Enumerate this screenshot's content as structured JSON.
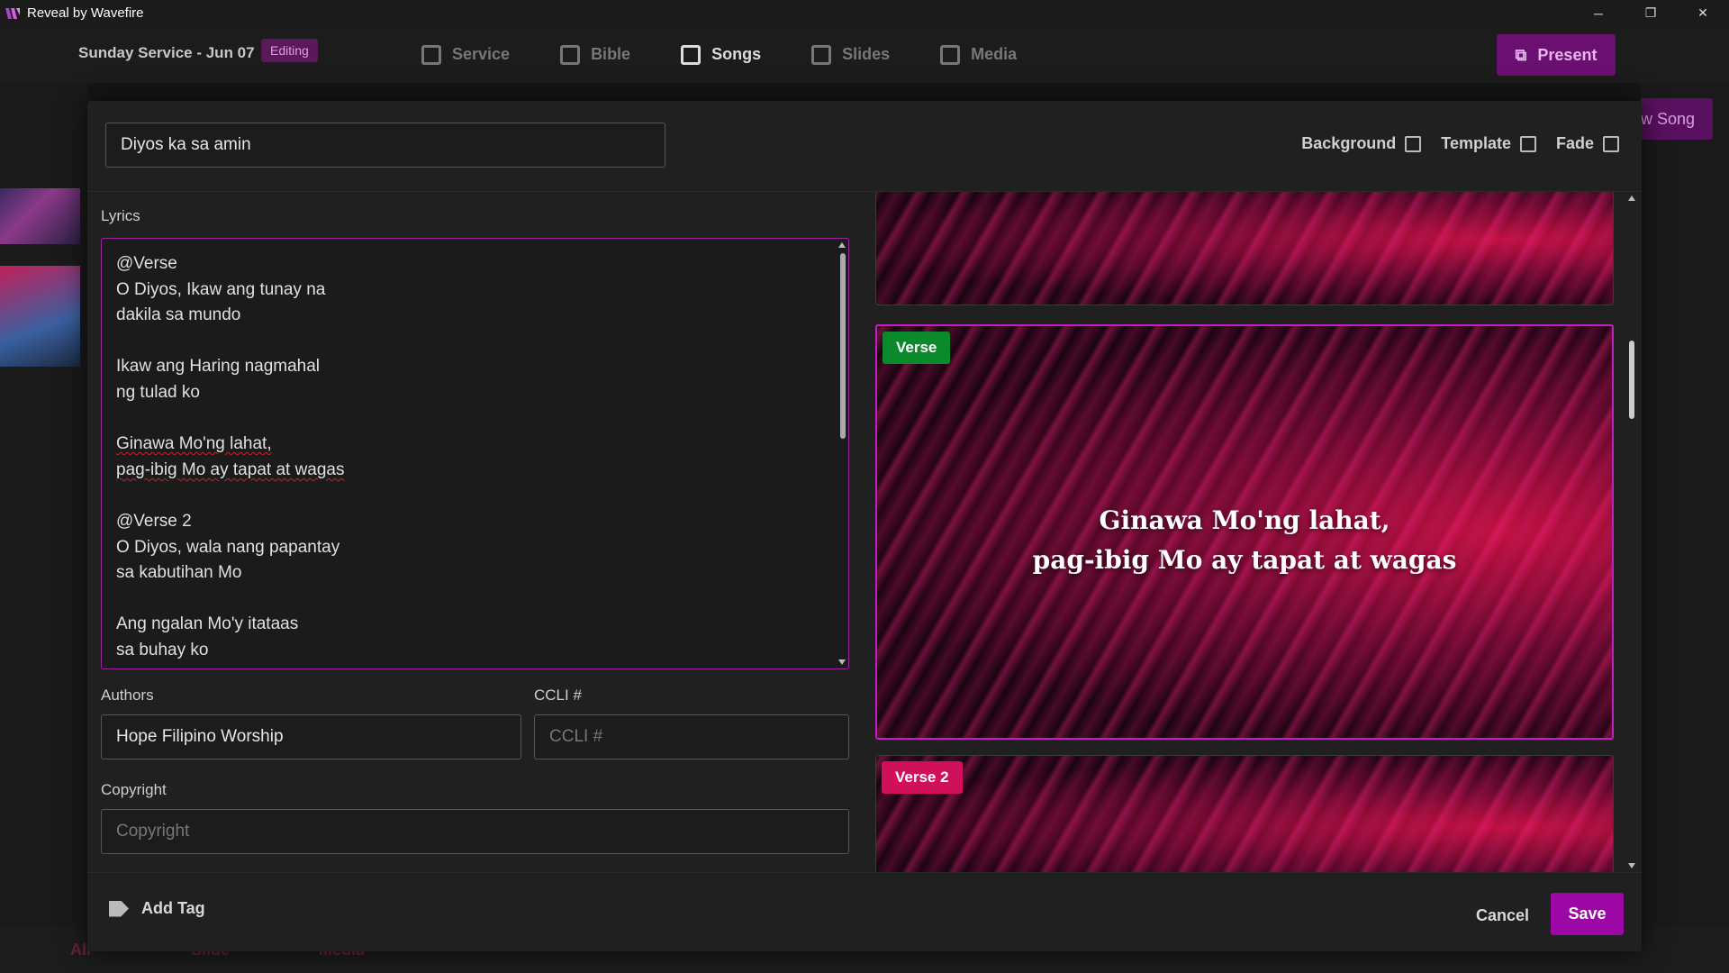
{
  "window": {
    "title": "Reveal by Wavefire",
    "minimize": "─",
    "restore": "❐",
    "close": "✕"
  },
  "topbar": {
    "service_name": "Sunday Service - Jun 07",
    "status_badge": "Editing",
    "nav": [
      {
        "label": "Service",
        "icon": "service-icon"
      },
      {
        "label": "Bible",
        "icon": "bible-icon"
      },
      {
        "label": "Songs",
        "icon": "songs-icon",
        "active": true
      },
      {
        "label": "Slides",
        "icon": "slides-icon"
      },
      {
        "label": "Media",
        "icon": "media-icon"
      }
    ],
    "present_label": "Present"
  },
  "background": {
    "new_song_label": "w Song"
  },
  "bottombar": {
    "all_label": "All",
    "slide_label": "Slide",
    "media_label": "Media"
  },
  "editor": {
    "title_value": "Diyos ka sa amin",
    "header_actions": {
      "background": "Background",
      "template": "Template",
      "fade": "Fade"
    },
    "lyrics_label": "Lyrics",
    "lyrics_lines": [
      "@Verse",
      "O Diyos, Ikaw ang tunay na",
      "dakila sa mundo",
      "",
      "Ikaw ang Haring nagmahal",
      "ng tulad ko",
      "",
      "Ginawa Mo'ng lahat,",
      "pag-ibig Mo ay tapat at wagas",
      "",
      "@Verse 2",
      "O Diyos, wala nang papantay",
      "sa kabutihan Mo",
      "",
      "Ang ngalan Mo'y itataas",
      "sa buhay ko"
    ],
    "authors_label": "Authors",
    "authors_value": "Hope Filipino Worship",
    "ccli_label": "CCLI #",
    "ccli_placeholder": "CCLI #",
    "copyright_label": "Copyright",
    "copyright_placeholder": "Copyright",
    "slides": [
      {
        "badge": "",
        "text": ""
      },
      {
        "badge": "Verse",
        "badge_color": "#0a8a2a",
        "text_line1": "Ginawa Mo'ng lahat,",
        "text_line2": "pag-ibig Mo ay tapat at wagas"
      },
      {
        "badge": "Verse 2",
        "badge_color": "#d0105a"
      }
    ],
    "add_tag_label": "Add Tag",
    "cancel_label": "Cancel",
    "save_label": "Save",
    "accent_color": "#9c07a6"
  }
}
